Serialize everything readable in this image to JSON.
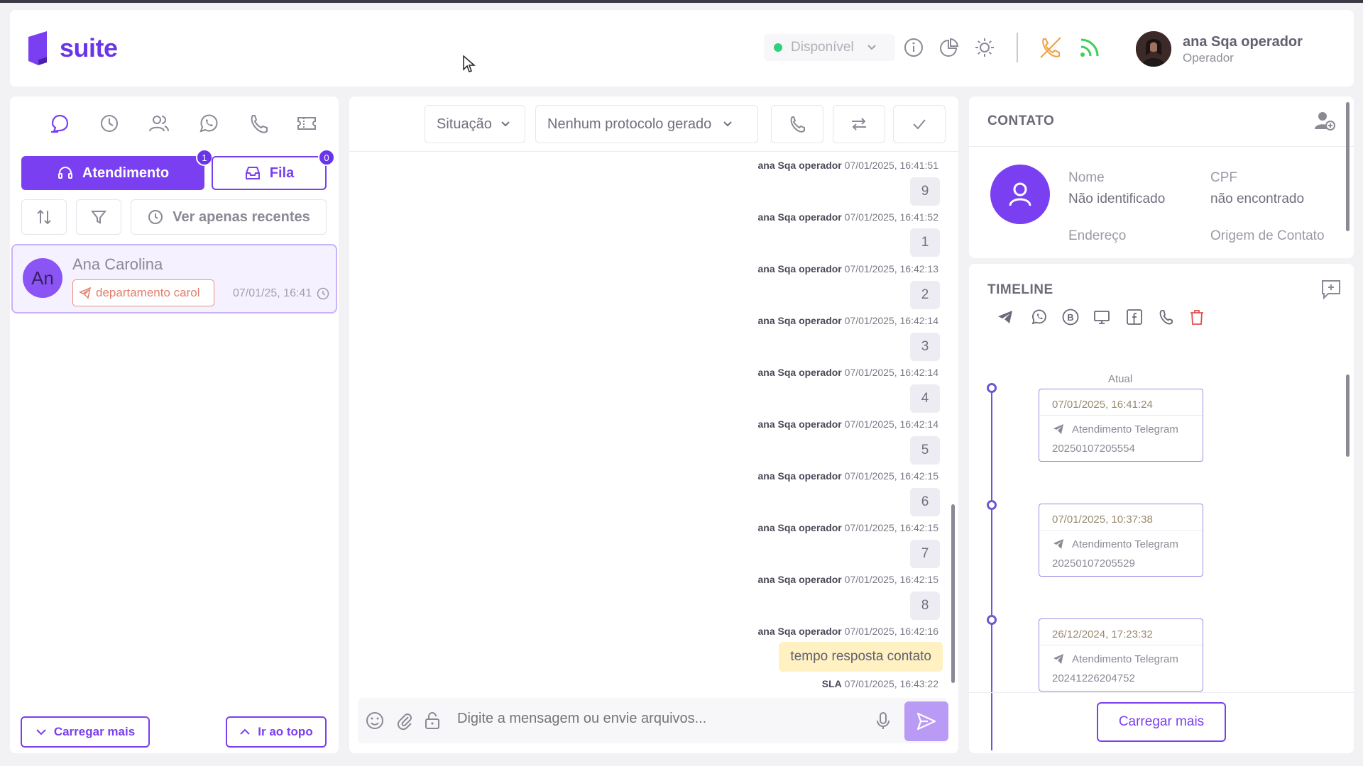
{
  "app": {
    "logo_text": "suite"
  },
  "header": {
    "status": "Disponível",
    "user_name": "ana Sqa operador",
    "user_role": "Operador"
  },
  "left": {
    "tab_atendimento": "Atendimento",
    "tab_atendimento_count": "1",
    "tab_fila": "Fila",
    "tab_fila_count": "0",
    "recent_filter": "Ver apenas recentes",
    "conversation": {
      "avatar": "An",
      "name": "Ana Carolina",
      "tag": "departamento carol",
      "time": "07/01/25, 16:41"
    },
    "load_more": "Carregar mais",
    "go_top": "Ir ao topo"
  },
  "chat": {
    "situacao": "Situação",
    "protocolo": "Nenhum protocolo gerado",
    "messages": [
      {
        "author": "ana Sqa operador",
        "time": "07/01/2025, 16:41:51",
        "text": "9"
      },
      {
        "author": "ana Sqa operador",
        "time": "07/01/2025, 16:41:52",
        "text": "1"
      },
      {
        "author": "ana Sqa operador",
        "time": "07/01/2025, 16:42:13",
        "text": "2"
      },
      {
        "author": "ana Sqa operador",
        "time": "07/01/2025, 16:42:14",
        "text": "3"
      },
      {
        "author": "ana Sqa operador",
        "time": "07/01/2025, 16:42:14",
        "text": "4"
      },
      {
        "author": "ana Sqa operador",
        "time": "07/01/2025, 16:42:14",
        "text": "5"
      },
      {
        "author": "ana Sqa operador",
        "time": "07/01/2025, 16:42:15",
        "text": "6"
      },
      {
        "author": "ana Sqa operador",
        "time": "07/01/2025, 16:42:15",
        "text": "7"
      },
      {
        "author": "ana Sqa operador",
        "time": "07/01/2025, 16:42:15",
        "text": "8"
      },
      {
        "author": "ana Sqa operador",
        "time": "07/01/2025, 16:42:16",
        "text": "tempo resposta contato"
      }
    ],
    "sla_author": "SLA",
    "sla_time": "07/01/2025, 16:43:22",
    "compose_placeholder": "Digite a mensagem ou envie arquivos..."
  },
  "contact": {
    "title": "CONTATO",
    "nome_label": "Nome",
    "nome_value": "Não identificado",
    "cpf_label": "CPF",
    "cpf_value": "não encontrado",
    "endereco_label": "Endereço",
    "origem_label": "Origem de Contato"
  },
  "timeline": {
    "title": "TIMELINE",
    "current_label": "Atual",
    "entries": [
      {
        "date": "07/01/2025,  16:41:24",
        "type": "Atendimento Telegram",
        "id": "20250107205554"
      },
      {
        "date": "07/01/2025,  10:37:38",
        "type": "Atendimento Telegram",
        "id": "20250107205529"
      },
      {
        "date": "26/12/2024,  17:23:32",
        "type": "Atendimento Telegram",
        "id": "20241226204752"
      }
    ],
    "load_more": "Carregar mais"
  },
  "colors": {
    "accent": "#7a3ff0",
    "status_online": "#31d07a",
    "call_icon": "#f0a040",
    "signal_icon": "#3ccf5a"
  }
}
